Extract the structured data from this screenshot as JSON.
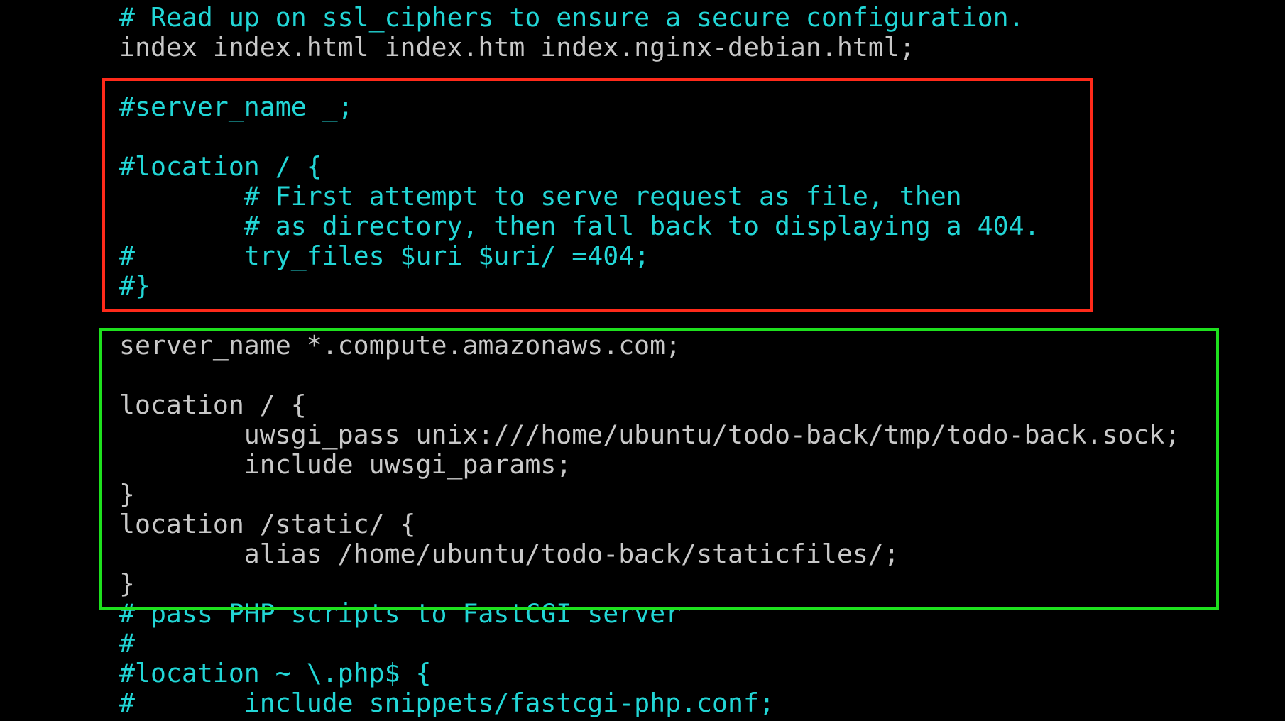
{
  "editor": {
    "colors": {
      "background": "#000000",
      "comment": "#22d6d6",
      "code": "#c8c8c8",
      "red_box": "#ff2a1a",
      "green_box": "#1ee01e"
    },
    "lines": [
      "# Read up on ssl_ciphers to ensure a secure configuration.",
      "index index.html index.htm index.nginx-debian.html;",
      "#server_name _;",
      "#location / {",
      "        # First attempt to serve request as file, then",
      "        # as directory, then fall back to displaying a 404.",
      "#       try_files $uri $uri/ =404;",
      "#}",
      "server_name *.compute.amazonaws.com;",
      "location / {",
      "        uwsgi_pass unix:///home/ubuntu/todo-back/tmp/todo-back.sock;",
      "        include uwsgi_params;",
      "}",
      "location /static/ {",
      "        alias /home/ubuntu/todo-back/staticfiles/;",
      "}",
      "# pass PHP scripts to FastCGI server",
      "#",
      "#location ~ \\.php$ {",
      "#       include snippets/fastcgi-php.conf;"
    ]
  }
}
